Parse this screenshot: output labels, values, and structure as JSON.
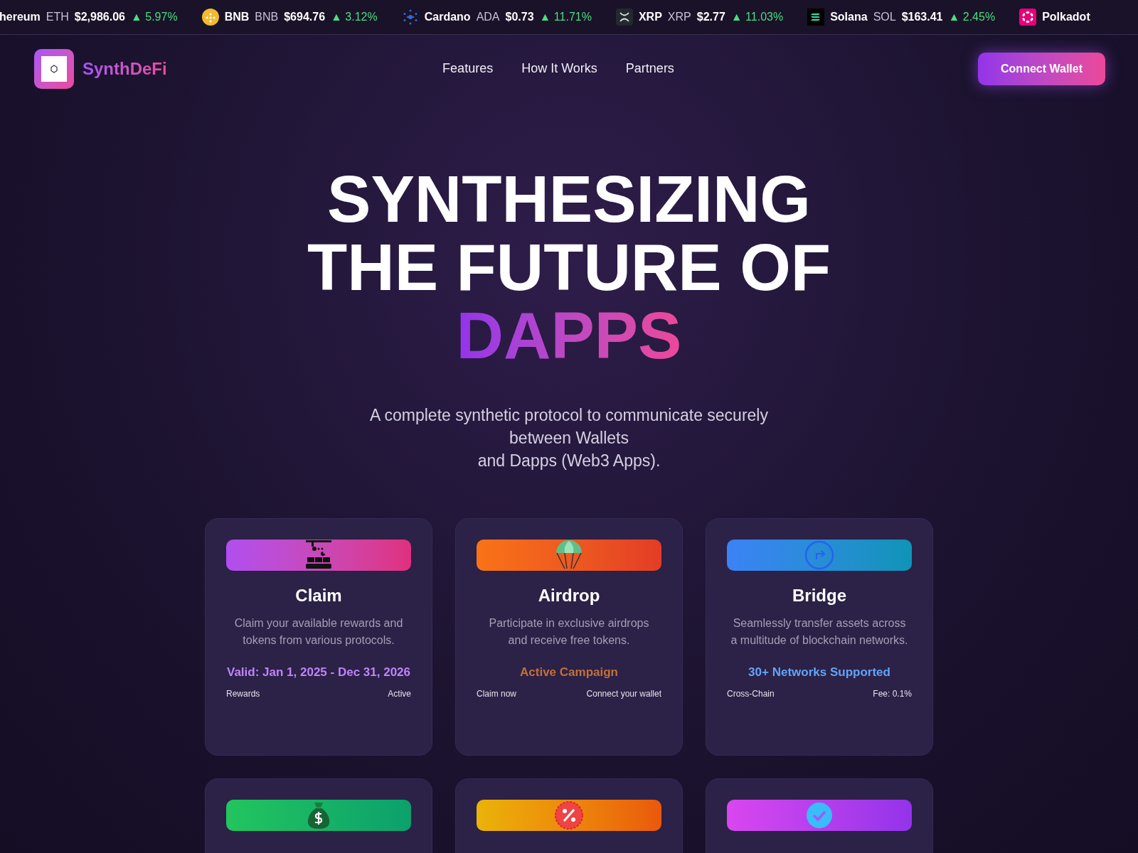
{
  "ticker": [
    {
      "name": "hereum",
      "symbol": "ETH",
      "price": "$2,986.06",
      "change": "▲ 5.97%"
    },
    {
      "name": "BNB",
      "symbol": "BNB",
      "price": "$694.76",
      "change": "▲ 3.12%"
    },
    {
      "name": "Cardano",
      "symbol": "ADA",
      "price": "$0.73",
      "change": "▲ 11.71%"
    },
    {
      "name": "XRP",
      "symbol": "XRP",
      "price": "$2.77",
      "change": "▲ 11.03%"
    },
    {
      "name": "Solana",
      "symbol": "SOL",
      "price": "$163.41",
      "change": "▲ 2.45%"
    },
    {
      "name": "Polkadot"
    }
  ],
  "header": {
    "brand": "SynthDeFi",
    "nav": [
      "Features",
      "How It Works",
      "Partners"
    ],
    "cta": "Connect Wallet"
  },
  "hero": {
    "title_lines": [
      "SYNTHESIZING",
      "THE FUTURE OF"
    ],
    "title_accent": "DAPPS",
    "subtitle_lines": [
      "A complete synthetic protocol to communicate securely",
      "between Wallets",
      "and Dapps (Web3 Apps)."
    ]
  },
  "cards": [
    {
      "kind": "factory",
      "title": "Claim",
      "description": "Claim your available rewards and tokens from various protocols.",
      "highlight": "Valid: Jan 1, 2025 - Dec 31, 2026",
      "color": "#c084fc",
      "footer_left": "Rewards",
      "footer_right": "Active"
    },
    {
      "kind": "parachute",
      "title": "Airdrop",
      "description": "Participate in exclusive airdrops and receive free tokens.",
      "highlight": "Active Campaign",
      "color": "#c2703a",
      "footer_left": "Claim now",
      "footer_right": "Connect your wallet"
    },
    {
      "kind": "arrow",
      "title": "Bridge",
      "description": "Seamlessly transfer assets across a multitude of blockchain networks.",
      "highlight": "30+ Networks Supported",
      "color": "#60a5fa",
      "footer_left": "Cross-Chain",
      "footer_right": "Fee: 0.1%"
    },
    {
      "kind": "moneybag"
    },
    {
      "kind": "percent"
    },
    {
      "kind": "check"
    }
  ]
}
